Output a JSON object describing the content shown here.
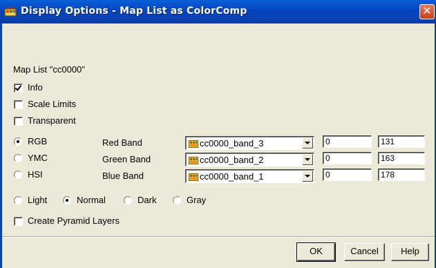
{
  "window": {
    "title": "Display Options - Map List as ColorComp",
    "close_symbol": "✕"
  },
  "map_list_label": "Map List \"cc0000\"",
  "options": {
    "info": {
      "label": "Info",
      "checked": true
    },
    "scale_limits": {
      "label": "Scale Limits",
      "checked": false
    },
    "transparent": {
      "label": "Transparent",
      "checked": false
    }
  },
  "color_model": {
    "selected": "RGB",
    "items": [
      {
        "label": "RGB"
      },
      {
        "label": "YMC"
      },
      {
        "label": "HSI"
      }
    ]
  },
  "bands": [
    {
      "label": "Red Band",
      "value": "cc0000_band_3",
      "min": "0",
      "max": "131"
    },
    {
      "label": "Green Band",
      "value": "cc0000_band_2",
      "min": "0",
      "max": "163"
    },
    {
      "label": "Blue Band",
      "value": "cc0000_band_1",
      "min": "0",
      "max": "178"
    }
  ],
  "brightness": {
    "selected": "Normal",
    "items": [
      {
        "label": "Light"
      },
      {
        "label": "Normal"
      },
      {
        "label": "Dark"
      },
      {
        "label": "Gray"
      }
    ]
  },
  "pyramid": {
    "label": "Create Pyramid Layers",
    "checked": false
  },
  "buttons": {
    "ok": "OK",
    "cancel": "Cancel",
    "help": "Help"
  },
  "icons": {
    "app": "raster-map-icon",
    "band": "raster-band-icon",
    "close": "close-icon",
    "dropdown": "chevron-down-icon"
  }
}
